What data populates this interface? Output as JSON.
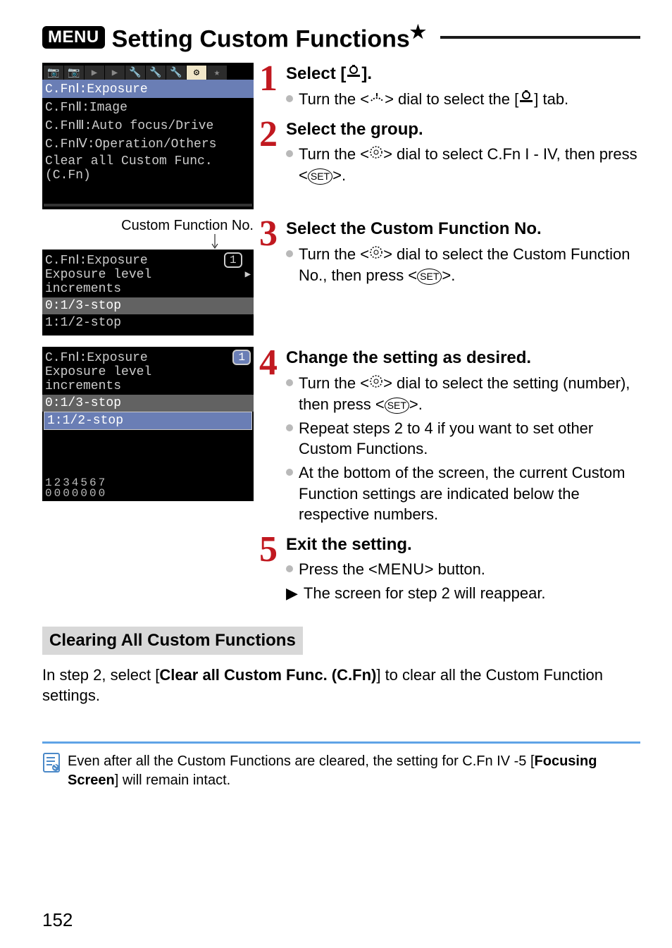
{
  "title_badge": "MENU",
  "title_text": "Setting Custom Functions",
  "title_star": "★",
  "lcd1": {
    "sel": "C.FnⅠ:Exposure",
    "lines": [
      "C.FnⅡ:Image",
      "C.FnⅢ:Auto focus/Drive",
      "C.FnⅣ:Operation/Others",
      "Clear all Custom Func. (C.Fn)"
    ]
  },
  "step1": {
    "title": "Select [",
    "title_end": "].",
    "bullet": "Turn the <",
    "bullet_mid": "> dial to select the [",
    "bullet_end": "] tab."
  },
  "step2": {
    "title": "Select the group.",
    "bullet": "Turn the <",
    "bullet_mid": "> dial to select C.Fn I - IV, then press <",
    "bullet_end": ">."
  },
  "cfn_label": "Custom Function No.",
  "lcd2a": {
    "h1": "C.FnⅠ:Exposure",
    "h2": "Exposure level increments",
    "box": "1",
    "opt1": "0:1/3-stop",
    "opt2": "1:1/2-stop"
  },
  "step3": {
    "title": "Select the Custom Function No.",
    "bullet": "Turn the <",
    "bullet_mid": "> dial to select the Custom Function No., then press <",
    "bullet_end": ">."
  },
  "lcd2b": {
    "h1": "C.FnⅠ:Exposure",
    "h2": "Exposure level increments",
    "box": "1",
    "opt1": "0:1/3-stop",
    "sel": "1:1/2-stop",
    "counter_top": "1234567",
    "counter_bot": "0000000"
  },
  "step4": {
    "title": "Change the setting as desired.",
    "b1a": "Turn the <",
    "b1b": "> dial to select the setting (number), then press <",
    "b1c": ">.",
    "b2": "Repeat steps 2 to 4 if you want to set other Custom Functions.",
    "b3": "At the bottom of the screen, the current Custom Function settings are indicated below the respective numbers."
  },
  "step5": {
    "title": "Exit the setting.",
    "b1a": "Press the <",
    "b1b": "> button.",
    "b2": "The screen for step 2 will reappear."
  },
  "menu_text": "MENU",
  "clearing": {
    "header": "Clearing All Custom Functions",
    "text_a": "In step 2, select [",
    "text_b": "Clear all Custom Func. (C.Fn)",
    "text_c": "] to clear all the Custom Function settings."
  },
  "note": {
    "a": "Even after all the Custom Functions are cleared, the setting for C.Fn IV -5 [",
    "b": "Focusing Screen",
    "c": "] will remain intact."
  },
  "page": "152"
}
